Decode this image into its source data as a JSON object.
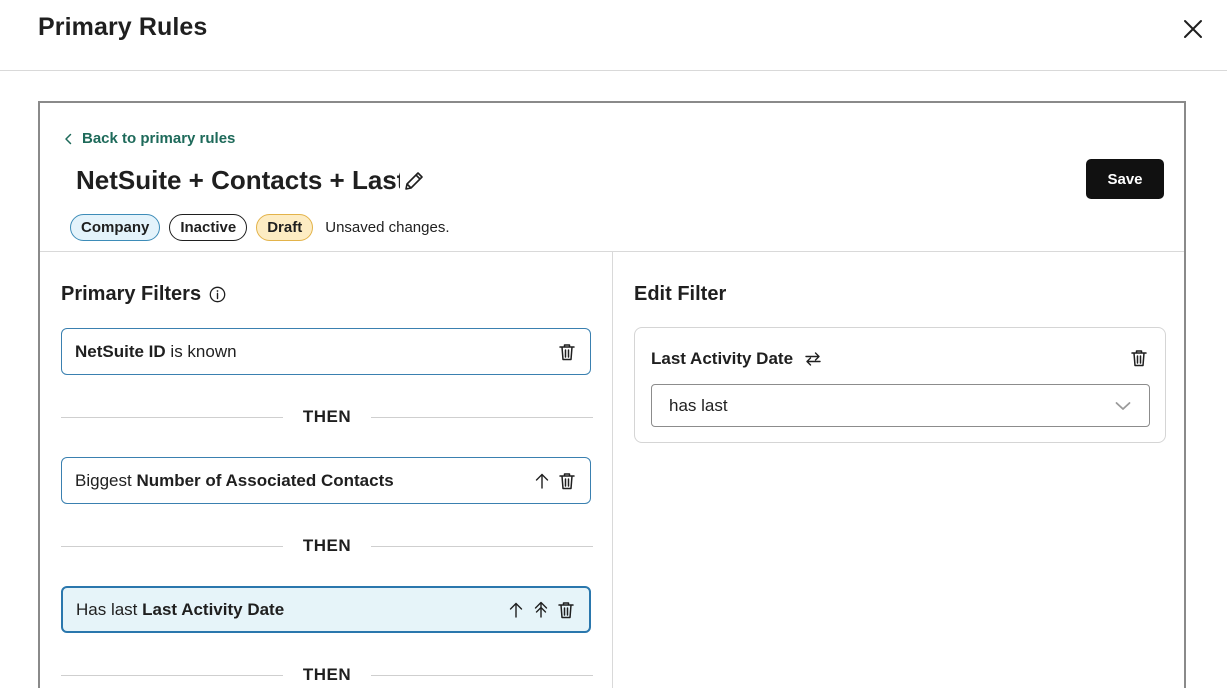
{
  "modal": {
    "title": "Primary Rules",
    "close_icon": "close-icon"
  },
  "panel": {
    "back_link": "Back to primary rules",
    "rule_title": "NetSuite + Contacts + Last Activity",
    "edit_icon": "pencil-icon",
    "save_label": "Save",
    "badges": {
      "company": "Company",
      "inactive": "Inactive",
      "draft": "Draft"
    },
    "unsaved": "Unsaved changes.",
    "colors": {
      "save_bg": "#111111",
      "link": "#1e6a5a",
      "card_border": "#3a80b0",
      "selected_bg": "#e6f4f9"
    }
  },
  "primary_filters": {
    "title": "Primary Filters",
    "info_icon": "info-icon",
    "then_label": "THEN",
    "filters": [
      {
        "prefix": "",
        "property": "NetSuite ID",
        "suffix": " is known",
        "icons": [
          "trash-icon"
        ]
      },
      {
        "prefix": "Biggest ",
        "property": "Number of Associated Contacts",
        "suffix": "",
        "icons": [
          "arrow-up-icon",
          "trash-icon"
        ]
      },
      {
        "prefix": "Has last ",
        "property": "Last Activity Date",
        "suffix": "",
        "icons": [
          "arrow-up-icon",
          "double-arrow-up-icon",
          "trash-icon"
        ]
      }
    ]
  },
  "edit_filter": {
    "title": "Edit Filter",
    "property": "Last Activity Date",
    "swap_icon": "swap-icon",
    "trash_icon": "trash-icon",
    "operator_value": "has last",
    "dropdown_icon": "chevron-down-icon"
  }
}
